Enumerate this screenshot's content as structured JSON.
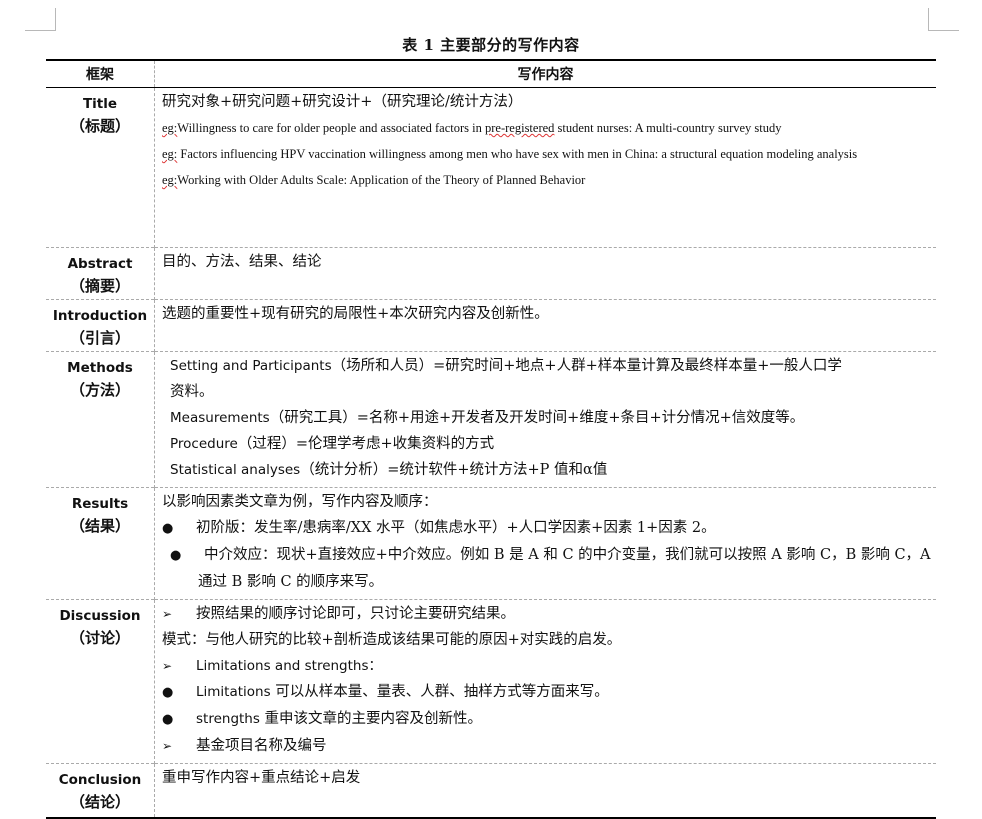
{
  "caption": "表 1  主要部分的写作内容",
  "header": {
    "col1": "框架",
    "col2": "写作内容"
  },
  "rows": {
    "title": {
      "en": "Title",
      "zh": "（标题）",
      "line1": "研究对象+研究问题+研究设计+（研究理论/统计方法）",
      "eg_label": "eg:",
      "eg1_a": "Willingness to care for older people and associated factors in ",
      "eg1_b": "pre-registered",
      "eg1_c": " student nurses: A multi-country survey study",
      "eg2_label": "eg:",
      "eg2": " Factors influencing HPV vaccination willingness among men who have sex with men in China: a structural equation modeling analysis",
      "eg3_label": "eg:",
      "eg3": "Working with Older Adults Scale: Application of the Theory of Planned Behavior"
    },
    "abstract": {
      "en": "Abstract",
      "zh": "（摘要）",
      "line1": "目的、方法、结果、结论"
    },
    "introduction": {
      "en": "Introduction",
      "zh": "（引言）",
      "line1": "选题的重要性+现有研究的局限性+本次研究内容及创新性。"
    },
    "methods": {
      "en": "Methods",
      "zh": "（方法）",
      "l1_en": "Setting and Participants",
      "l1_zh": "（场所和人员）=研究时间+地点+人群+样本量计算及最终样本量+一般人口学",
      "l1_cont": "资料。",
      "l2_en": "Measurements",
      "l2_zh": "（研究工具）=名称+用途+开发者及开发时间+维度+条目+计分情况+信效度等。",
      "l3_en": "Procedure",
      "l3_zh": "（过程）=伦理学考虑+收集资料的方式",
      "l4_en": "Statistical analyses",
      "l4_zh": "（统计分析）=统计软件+统计方法+P 值和α值"
    },
    "results": {
      "en": "Results",
      "zh": "（结果）",
      "line1": "以影响因素类文章为例，写作内容及顺序：",
      "b1": "初阶版：发生率/患病率/XX 水平（如焦虑水平）+人口学因素+因素 1+因素 2。",
      "b2": "中介效应：现状+直接效应+中介效应。例如 B 是 A 和 C 的中介变量，我们就可以按照 A 影响 C，B 影响 C，A 通过 B 影响 C 的顺序来写。"
    },
    "discussion": {
      "en": "Discussion",
      "zh": "（讨论）",
      "a1": "按照结果的顺序讨论即可，只讨论主要研究结果。",
      "line2": "模式：与他人研究的比较+剖析造成该结果可能的原因+对实践的启发。",
      "a2": "Limitations and strengths：",
      "b1_en": "Limitations",
      "b1_zh": " 可以从样本量、量表、人群、抽样方式等方面来写。",
      "b2_en": "strengths",
      "b2_zh": " 重申该文章的主要内容及创新性。",
      "a3": "基金项目名称及编号"
    },
    "conclusion": {
      "en": "Conclusion",
      "zh": "（结论）",
      "line1": "重申写作内容+重点结论+启发"
    }
  },
  "symbols": {
    "bullet": "●",
    "arrow": "➢"
  }
}
